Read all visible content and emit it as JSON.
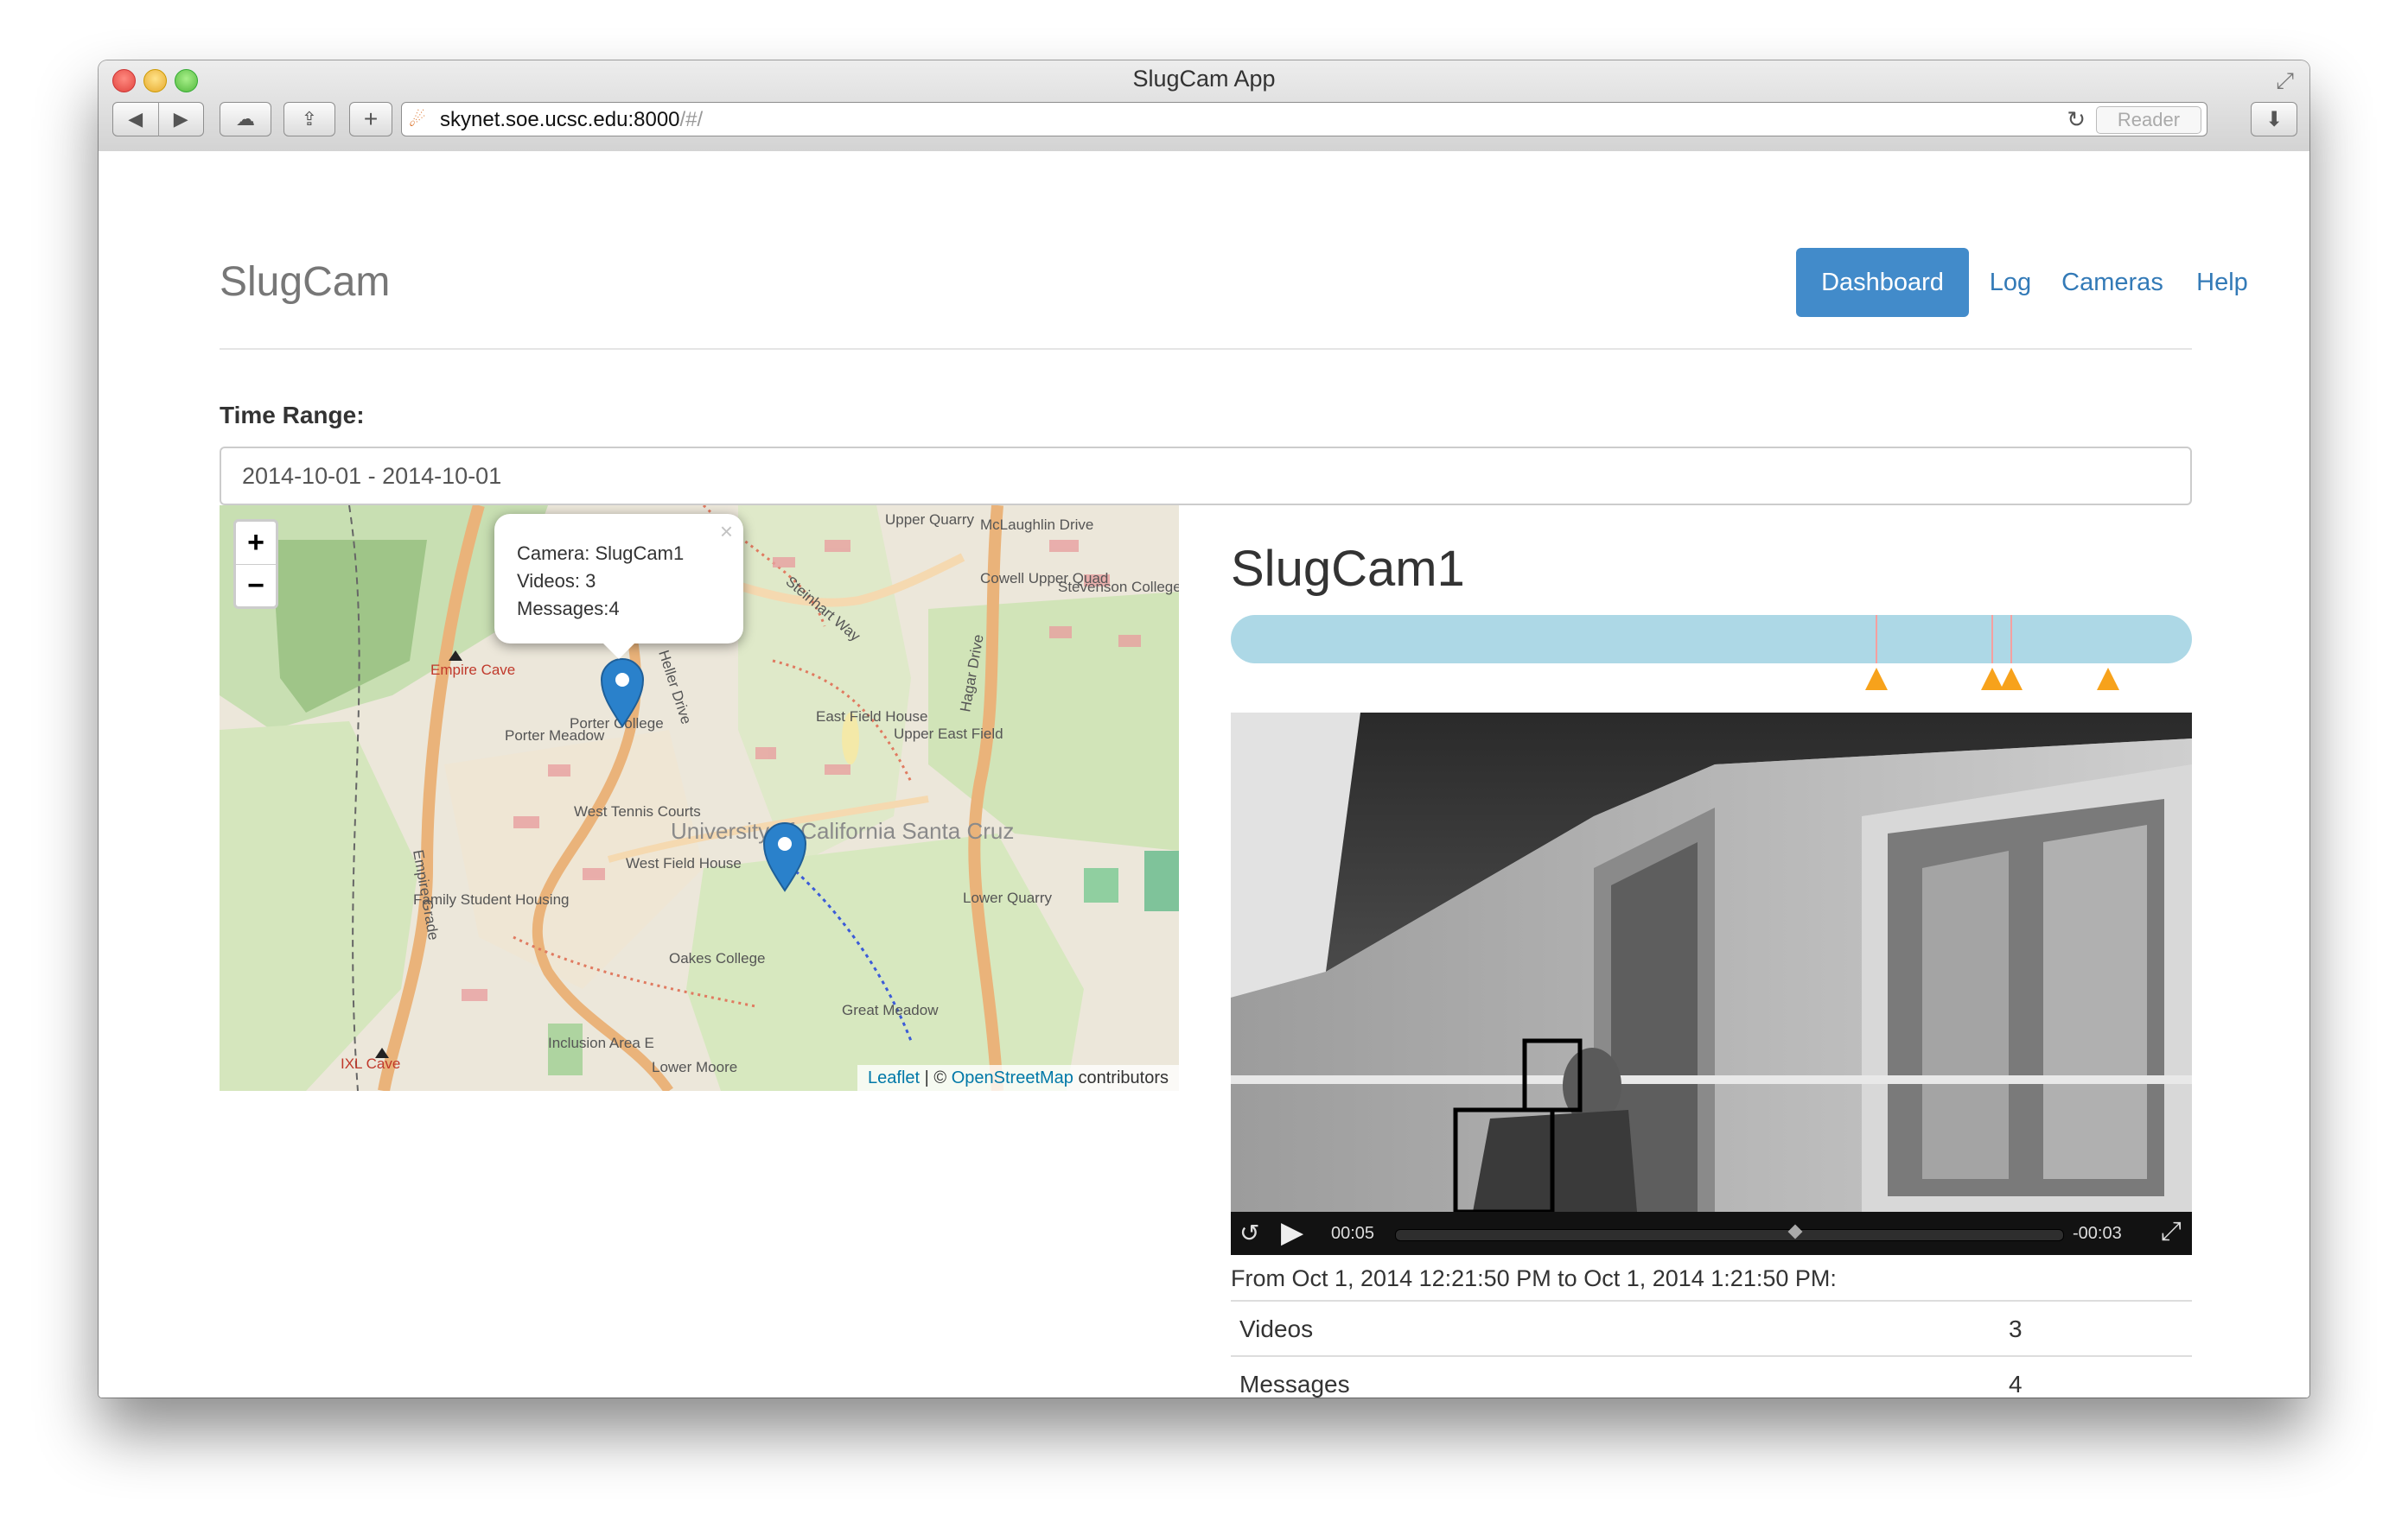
{
  "browser": {
    "window_title": "SlugCam App",
    "url_host": "skynet.soe.ucsc.edu:8000",
    "url_path": "/#/",
    "reader_label": "Reader",
    "icons": {
      "back": "back-arrow-icon",
      "forward": "forward-arrow-icon",
      "cloud": "cloud-icon",
      "share": "share-icon",
      "new_tab": "plus-icon",
      "reload": "reload-icon",
      "download": "download-icon",
      "fullscreen": "fullscreen-icon"
    }
  },
  "navbar": {
    "brand": "SlugCam",
    "items": [
      {
        "label": "Dashboard",
        "active": true
      },
      {
        "label": "Log",
        "active": false
      },
      {
        "label": "Cameras",
        "active": false
      },
      {
        "label": "Help",
        "active": false
      }
    ]
  },
  "time_range": {
    "label": "Time Range:",
    "value": "2014-10-01 - 2014-10-01"
  },
  "map": {
    "zoom_in": "+",
    "zoom_out": "−",
    "popup": {
      "close": "×",
      "camera": "Camera: SlugCam1",
      "videos": "Videos: 3",
      "messages": "Messages:4"
    },
    "labels": [
      "Empire Cave",
      "Porter College",
      "Porter Meadow",
      "West Tennis Courts",
      "West Field House",
      "Family Student Housing",
      "Empire Grade",
      "Heller Drive",
      "University of California Santa Cruz",
      "East Field House",
      "Upper East Field",
      "Hagar Drive",
      "Cowell Upper Quad",
      "Stevenson College",
      "McLaughlin Drive",
      "Upper Quarry",
      "Lower Quarry",
      "Oakes College",
      "Great Meadow",
      "Inclusion Area E",
      "Lower Moore",
      "IXL Cave",
      "Steinhart Way"
    ],
    "attribution": {
      "leaflet": "Leaflet",
      "sep": "| ©",
      "osm": "OpenStreetMap",
      "contributors": "contributors"
    },
    "marker_color": "#2a81cb"
  },
  "camera": {
    "title": "SlugCam1",
    "timeline_color": "#add8e6",
    "event_color": "#f7a21b",
    "video": {
      "current_time": "00:05",
      "remaining_time": "-00:03",
      "progress": 0.6
    },
    "summary": "From Oct 1, 2014 12:21:50 PM to Oct 1, 2014 1:21:50 PM:",
    "stats": [
      {
        "label": "Videos",
        "value": "3"
      },
      {
        "label": "Messages",
        "value": "4"
      }
    ]
  }
}
